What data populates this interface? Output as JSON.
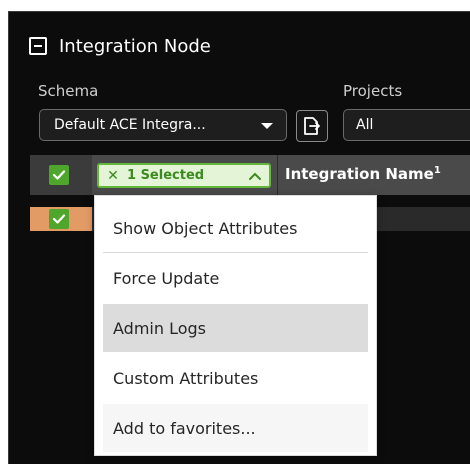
{
  "panel": {
    "title": "Integration Node",
    "collapse_icon": "collapse-minus-icon"
  },
  "filters": {
    "schema_label": "Schema",
    "schema_value": "Default ACE Integra...",
    "projects_label": "Projects",
    "projects_value": "All",
    "export_icon": "export-icon"
  },
  "table": {
    "selected_chip": {
      "count_text": "1 Selected",
      "clear_icon": "✕"
    },
    "column_header": "Integration Name",
    "sort_order": "1",
    "row_highlight_color": "#e39b65",
    "accent_color": "#4ea62c"
  },
  "context_menu": {
    "items": [
      {
        "label": "Show Object Attributes"
      },
      {
        "label": "Force Update"
      },
      {
        "label": "Admin Logs"
      },
      {
        "label": "Custom Attributes"
      },
      {
        "label": "Add to favorites..."
      }
    ],
    "hovered_index": 2
  }
}
